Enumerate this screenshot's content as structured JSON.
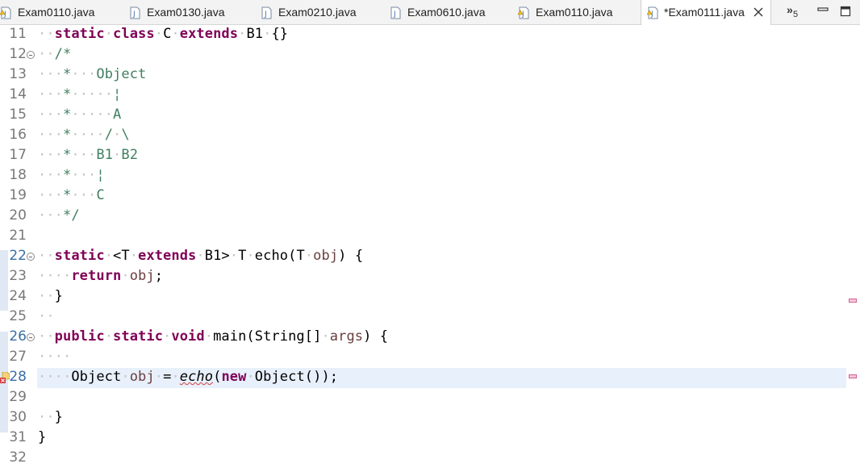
{
  "tabs": [
    {
      "label": "Exam0110.java",
      "icon": "java-file-warning-icon",
      "active": false
    },
    {
      "label": "Exam0130.java",
      "icon": "java-file-icon",
      "active": false
    },
    {
      "label": "Exam0210.java",
      "icon": "java-file-icon",
      "active": false
    },
    {
      "label": "Exam0610.java",
      "icon": "java-file-icon",
      "active": false
    },
    {
      "label": "Exam0110.java",
      "icon": "java-file-warning-icon",
      "active": false
    },
    {
      "label": "*Exam0111.java",
      "icon": "java-file-warning-icon",
      "active": true
    }
  ],
  "overflow": {
    "chevron": "»",
    "count": "5"
  },
  "editor": {
    "lines": [
      {
        "n": "11",
        "text": "static class C extends B1 {}"
      },
      {
        "n": "12",
        "text": "/*"
      },
      {
        "n": "13",
        "text": "*   Object"
      },
      {
        "n": "14",
        "text": "*     ¦"
      },
      {
        "n": "15",
        "text": "*     A"
      },
      {
        "n": "16",
        "text": "*    / \\"
      },
      {
        "n": "17",
        "text": "*   B1 B2"
      },
      {
        "n": "18",
        "text": "*   ¦"
      },
      {
        "n": "19",
        "text": "*   C"
      },
      {
        "n": "20",
        "text": "*/"
      },
      {
        "n": "21",
        "text": ""
      },
      {
        "n": "22",
        "text": "static <T extends B1> T echo(T obj) {"
      },
      {
        "n": "23",
        "text": "return obj;"
      },
      {
        "n": "24",
        "text": "}"
      },
      {
        "n": "25",
        "text": ""
      },
      {
        "n": "26",
        "text": "public static void main(String[] args) {"
      },
      {
        "n": "27",
        "text": ""
      },
      {
        "n": "28",
        "text": "Object obj = echo(new Object());"
      },
      {
        "n": "29",
        "text": ""
      },
      {
        "n": "30",
        "text": "}"
      },
      {
        "n": "31",
        "text": "}"
      },
      {
        "n": "32",
        "text": ""
      }
    ],
    "tokens": {
      "l11": [
        "static",
        "class",
        "C",
        "extends",
        "B1",
        "{}"
      ],
      "l12": "/*",
      "l13": [
        "*",
        "Object"
      ],
      "l14": [
        "*",
        "¦"
      ],
      "l15": [
        "*",
        "A"
      ],
      "l16": [
        "*",
        "/",
        "\\"
      ],
      "l17": [
        "*",
        "B1",
        "B2"
      ],
      "l18": [
        "*",
        "¦"
      ],
      "l19": [
        "*",
        "C"
      ],
      "l20": "*/",
      "l22": [
        "static",
        "<T",
        "extends",
        "B1>",
        "T",
        "echo(T",
        "obj",
        ") {"
      ],
      "l23": [
        "return",
        "obj",
        ";"
      ],
      "l24": "}",
      "l26": [
        "public",
        "static",
        "void",
        "main(String[]",
        "args",
        ") {"
      ],
      "l28": [
        "Object",
        "obj",
        "=",
        "echo",
        "(",
        "new",
        "Object());"
      ],
      "l30": "}",
      "l31": "}"
    }
  },
  "colors": {
    "keyword": "#7f0055",
    "comment": "#3f7f5f",
    "variable": "#6a3e3e",
    "currentLine": "#e8f0fb",
    "error": "#d04040"
  }
}
